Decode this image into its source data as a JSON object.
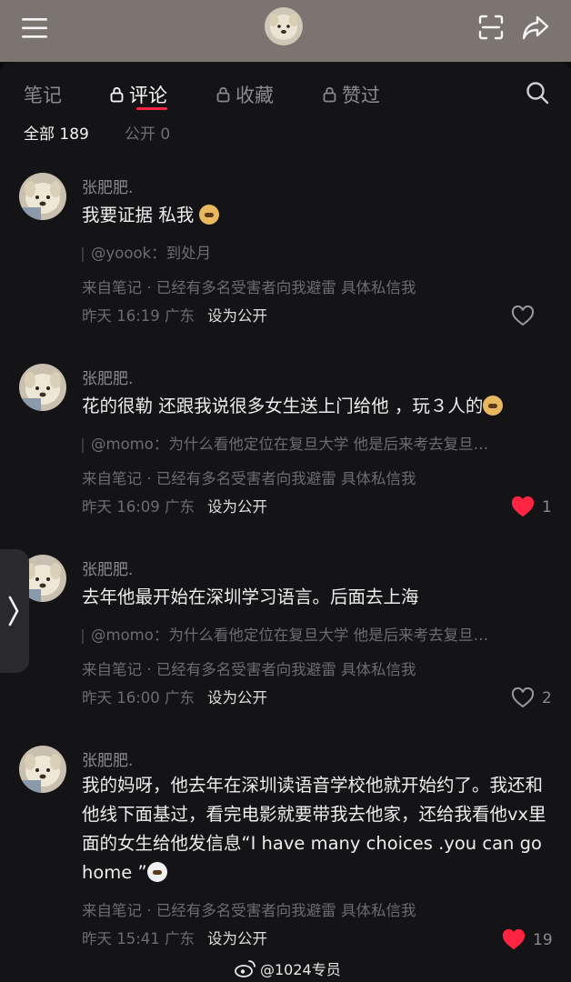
{
  "tabs": [
    {
      "label": "笔记",
      "locked": false,
      "active": false
    },
    {
      "label": "评论",
      "locked": true,
      "active": true
    },
    {
      "label": "收藏",
      "locked": true,
      "active": false
    },
    {
      "label": "赞过",
      "locked": true,
      "active": false
    }
  ],
  "filters": [
    {
      "label": "全部 189",
      "active": true
    },
    {
      "label": "公开 0",
      "active": false
    }
  ],
  "colors": {
    "accent": "#ff2442",
    "background": "#141416",
    "topbar": "#7c7470",
    "liked": "#ff2442"
  },
  "comments": [
    {
      "author": "张肥肥.",
      "text": "我要证据 私我",
      "reply": "@yoook：到处月",
      "source": "来自笔记 · 已经有多名受害者向我避雷 具体私信我",
      "time": "昨天 16:19 广东",
      "action": "设为公开",
      "likes": "",
      "liked": false
    },
    {
      "author": "张肥肥.",
      "text": "花的很勒 还跟我说很多女生送上门给他 ，玩３人的",
      "reply": "@momo：为什么看他定位在复旦大学 他是后来考去复旦…",
      "source": "来自笔记 · 已经有多名受害者向我避雷 具体私信我",
      "time": "昨天 16:09 广东",
      "action": "设为公开",
      "likes": "1",
      "liked": true
    },
    {
      "author": "张肥肥.",
      "text": "去年他最开始在深圳学习语言。后面去上海",
      "reply": "@momo：为什么看他定位在复旦大学 他是后来考去复旦…",
      "source": "来自笔记 · 已经有多名受害者向我避雷 具体私信我",
      "time": "昨天 16:00 广东",
      "action": "设为公开",
      "likes": "2",
      "liked": false
    },
    {
      "author": "张肥肥.",
      "text": "我的妈呀，他去年在深圳读语音学校他就开始约了。我还和他线下面基过，看完电影就要带我去他家，还给我看他vx里面的女生给他发信息“I have many choices .you can go home ”",
      "reply": "",
      "source": "来自笔记 · 已经有多名受害者向我避雷 具体私信我",
      "time": "昨天 15:41 广东",
      "action": "设为公开",
      "likes": "19",
      "liked": true
    }
  ],
  "watermark": "@1024专员"
}
